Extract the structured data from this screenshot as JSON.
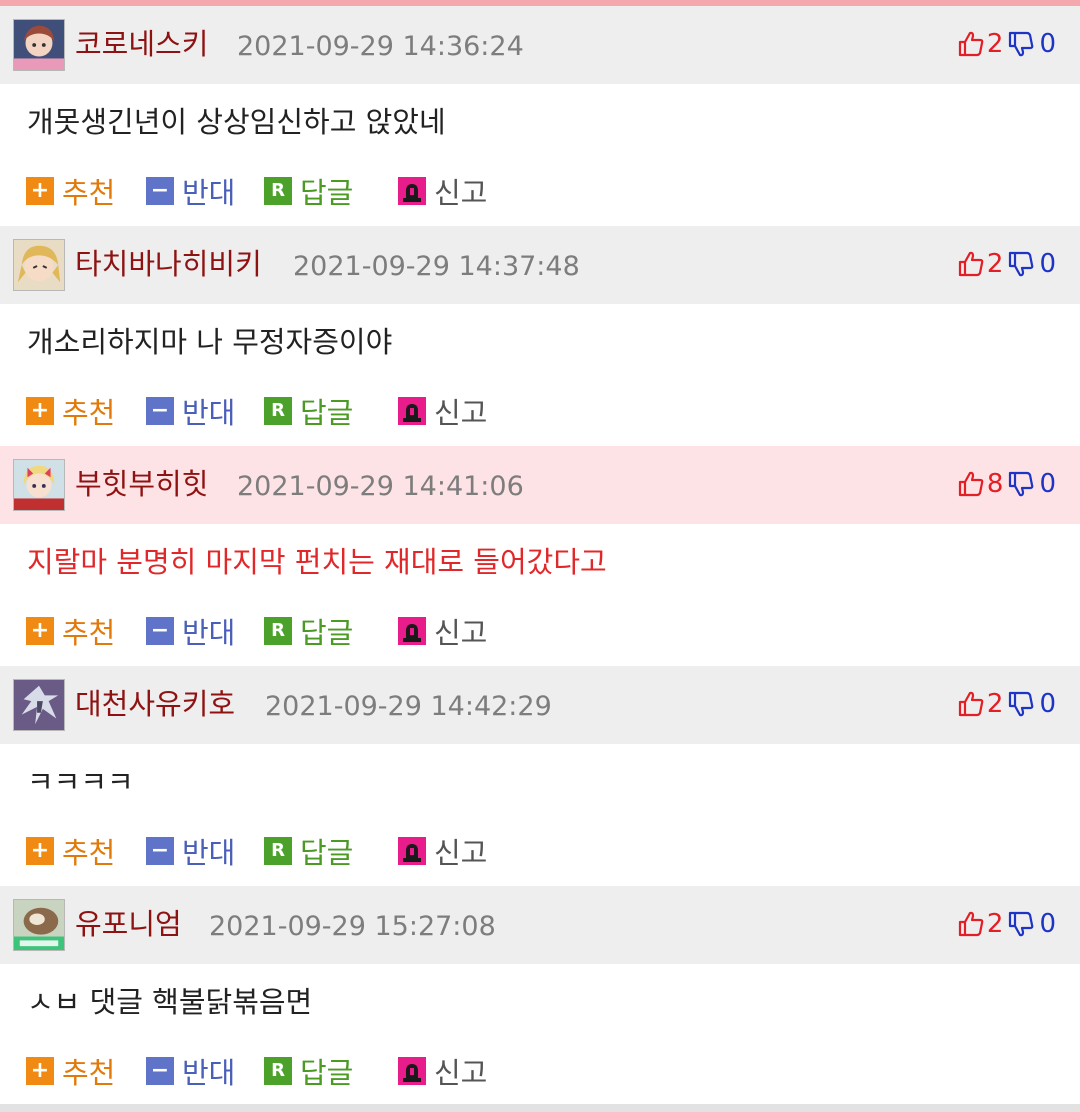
{
  "colors": {
    "nickname": "#8e1212",
    "timestamp": "#7d7d7d",
    "upvote": "#e31e24",
    "downvote": "#1e34c4",
    "recommend": "#f08a12",
    "oppose": "#5f74c9",
    "reply": "#4ba12a",
    "report": "#e81c8a",
    "highlight_bg": "#fde3e5",
    "highlight_text": "#e0282a"
  },
  "actions": {
    "recommend_label": "추천",
    "oppose_label": "반대",
    "reply_label": "답글",
    "report_label": "신고",
    "recommend_icon": "+",
    "oppose_icon": "−",
    "reply_icon": "R"
  },
  "comments": [
    {
      "nickname": "코로네스키",
      "timestamp": "2021-09-29 14:36:24",
      "up": "2",
      "down": "0",
      "body": "개못생긴년이 상상임신하고 앉았네",
      "highlight": false,
      "avatar": "anime-girl-avatar"
    },
    {
      "nickname": "타치바나히비키",
      "timestamp": "2021-09-29 14:37:48",
      "up": "2",
      "down": "0",
      "body": "개소리하지마 나 무정자증이야",
      "highlight": false,
      "avatar": "anime-blonde-avatar"
    },
    {
      "nickname": "부힛부히힛",
      "timestamp": "2021-09-29 14:41:06",
      "up": "8",
      "down": "0",
      "body": "지랄마 분명히 마지막 펀치는 재대로 들어갔다고",
      "highlight": true,
      "avatar": "anime-blonde-bow-avatar"
    },
    {
      "nickname": "대천사유키호",
      "timestamp": "2021-09-29 14:42:29",
      "up": "2",
      "down": "0",
      "body": "ㅋㅋㅋㅋ",
      "highlight": false,
      "avatar": "winged-avatar"
    },
    {
      "nickname": "유포니엄",
      "timestamp": "2021-09-29 15:27:08",
      "up": "2",
      "down": "0",
      "body": "ㅅㅂ 댓글 핵불닭볶음면",
      "highlight": false,
      "avatar": "photo-avatar"
    }
  ]
}
